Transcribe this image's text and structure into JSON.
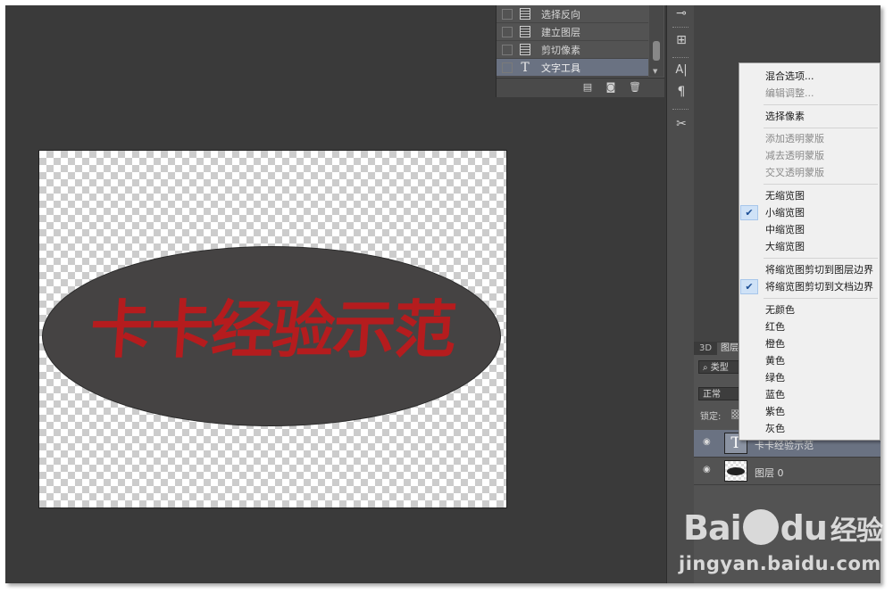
{
  "history": {
    "items": [
      {
        "label": "选择反向",
        "icon": "document-icon",
        "active": false
      },
      {
        "label": "建立图层",
        "icon": "document-icon",
        "active": false
      },
      {
        "label": "剪切像素",
        "icon": "document-icon",
        "active": false
      },
      {
        "label": "文字工具",
        "icon": "type-icon",
        "active": true
      }
    ],
    "footer_icons": [
      "new-document-from-state-icon",
      "camera-icon",
      "trash-icon"
    ]
  },
  "toolbar": {
    "tools": [
      "brush-preset-icon",
      "clone-source-icon",
      "character-icon",
      "paragraph-icon",
      "tool-preset-icon"
    ],
    "character_glyph": "A|",
    "paragraph_glyph": "¶"
  },
  "canvas": {
    "text": "卡卡经验示范",
    "text_color": "#b51c1e",
    "ellipse_color": "#454343"
  },
  "layers": {
    "tabs": [
      "3D",
      "图层"
    ],
    "kind_label": "类型",
    "blend_mode": "正常",
    "lock_label": "锁定:",
    "rows": [
      {
        "name": "卡卡经验示范",
        "thumb": "type",
        "selected": true
      },
      {
        "name": "图层 0",
        "thumb": "image",
        "selected": false
      }
    ]
  },
  "context_menu": {
    "items": [
      {
        "label": "混合选项...",
        "enabled": true,
        "checked": false
      },
      {
        "label": "编辑调整...",
        "enabled": false,
        "checked": false
      },
      {
        "separator": true
      },
      {
        "label": "选择像素",
        "enabled": true,
        "checked": false
      },
      {
        "separator": true
      },
      {
        "label": "添加透明蒙版",
        "enabled": false,
        "checked": false
      },
      {
        "label": "减去透明蒙版",
        "enabled": false,
        "checked": false
      },
      {
        "label": "交叉透明蒙版",
        "enabled": false,
        "checked": false
      },
      {
        "separator": true
      },
      {
        "label": "无缩览图",
        "enabled": true,
        "checked": false
      },
      {
        "label": "小缩览图",
        "enabled": true,
        "checked": true
      },
      {
        "label": "中缩览图",
        "enabled": true,
        "checked": false
      },
      {
        "label": "大缩览图",
        "enabled": true,
        "checked": false
      },
      {
        "separator": true
      },
      {
        "label": "将缩览图剪切到图层边界",
        "enabled": true,
        "checked": false
      },
      {
        "label": "将缩览图剪切到文档边界",
        "enabled": true,
        "checked": true
      },
      {
        "separator": true
      },
      {
        "label": "无颜色",
        "enabled": true,
        "checked": false
      },
      {
        "label": "红色",
        "enabled": true,
        "checked": false
      },
      {
        "label": "橙色",
        "enabled": true,
        "checked": false
      },
      {
        "label": "黄色",
        "enabled": true,
        "checked": false
      },
      {
        "label": "绿色",
        "enabled": true,
        "checked": false
      },
      {
        "label": "蓝色",
        "enabled": true,
        "checked": false
      },
      {
        "label": "紫色",
        "enabled": true,
        "checked": false
      },
      {
        "label": "灰色",
        "enabled": true,
        "checked": false
      }
    ]
  },
  "watermark": {
    "logo_left": "Bai",
    "logo_right": "du",
    "logo_cn": "经验",
    "url": "jingyan.baidu.com"
  }
}
